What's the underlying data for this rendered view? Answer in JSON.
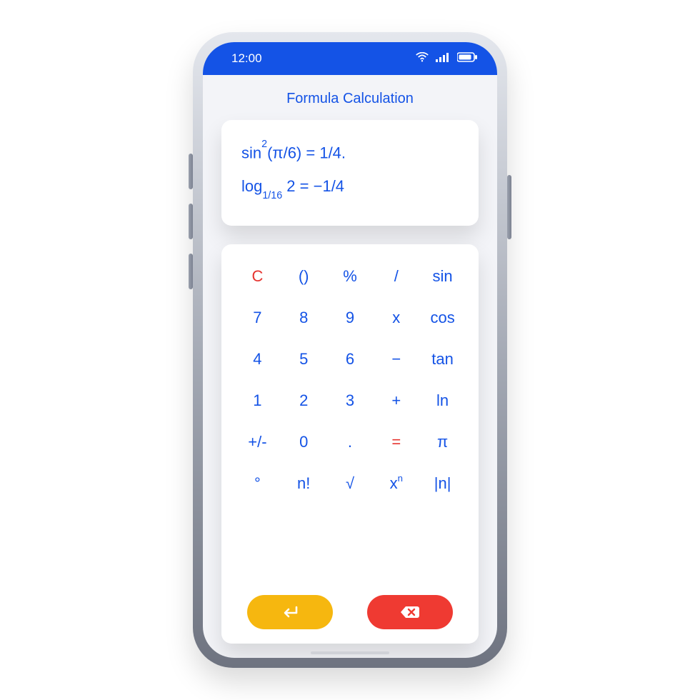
{
  "status": {
    "time": "12:00"
  },
  "title": "Formula Calculation",
  "display": {
    "line1_html": "sin<sup>2</sup>(π/6) = 1/4.",
    "line2_html": "log<sub>1/16</sub> 2 = −1/4"
  },
  "keys": [
    [
      {
        "label": "C",
        "color": "red",
        "name": "clear-key"
      },
      {
        "label": "()",
        "name": "paren-key"
      },
      {
        "label": "%",
        "name": "percent-key"
      },
      {
        "label": "/",
        "name": "divide-key"
      },
      {
        "label": "sin",
        "name": "sin-key"
      }
    ],
    [
      {
        "label": "7",
        "name": "key-7"
      },
      {
        "label": "8",
        "name": "key-8"
      },
      {
        "label": "9",
        "name": "key-9"
      },
      {
        "label": "x",
        "name": "multiply-key"
      },
      {
        "label": "cos",
        "name": "cos-key"
      }
    ],
    [
      {
        "label": "4",
        "name": "key-4"
      },
      {
        "label": "5",
        "name": "key-5"
      },
      {
        "label": "6",
        "name": "key-6"
      },
      {
        "label": "−",
        "name": "minus-key"
      },
      {
        "label": "tan",
        "name": "tan-key"
      }
    ],
    [
      {
        "label": "1",
        "name": "key-1"
      },
      {
        "label": "2",
        "name": "key-2"
      },
      {
        "label": "3",
        "name": "key-3"
      },
      {
        "label": "+",
        "name": "plus-key"
      },
      {
        "label": "ln",
        "name": "ln-key"
      }
    ],
    [
      {
        "label": "+/-",
        "name": "sign-key"
      },
      {
        "label": "0",
        "name": "key-0"
      },
      {
        "label": ".",
        "name": "decimal-key"
      },
      {
        "label": "=",
        "color": "red",
        "name": "equals-key"
      },
      {
        "label": "π",
        "name": "pi-key"
      }
    ],
    [
      {
        "label": "°",
        "name": "degree-key"
      },
      {
        "label": "n!",
        "name": "factorial-key"
      },
      {
        "label": "√",
        "name": "sqrt-key"
      },
      {
        "label_html": "x<sup>n</sup>",
        "name": "power-key"
      },
      {
        "label": "|n|",
        "name": "abs-key"
      }
    ]
  ],
  "actions": {
    "enter": "enter",
    "delete": "delete"
  },
  "colors": {
    "primary": "#1453e6",
    "accent_enter": "#f6b70f",
    "accent_delete": "#ef3a32"
  }
}
